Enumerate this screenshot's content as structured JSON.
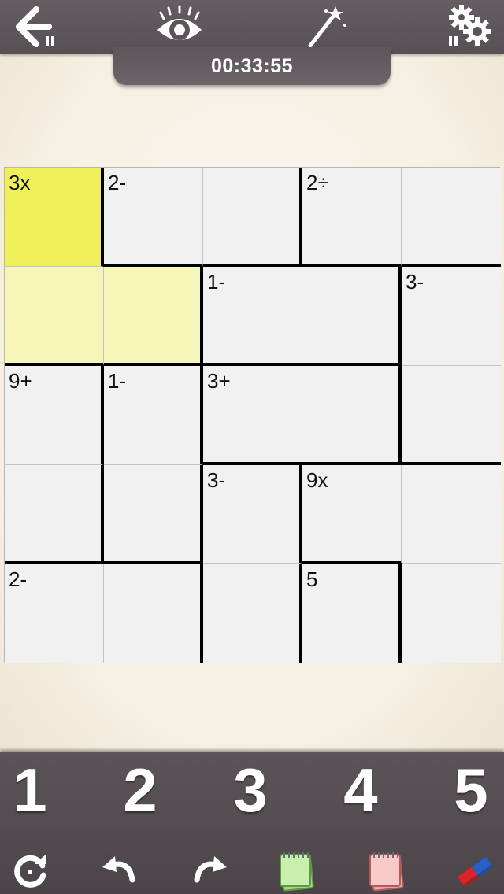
{
  "header": {
    "timer": "00:33:55",
    "icons": [
      "back-icon",
      "eye-icon",
      "magic-wand-icon",
      "settings-icon"
    ]
  },
  "puzzle": {
    "size": 5,
    "cells": [
      {
        "clue": "3x",
        "state": "selected"
      },
      {
        "clue": "2-",
        "state": "normal"
      },
      {
        "clue": "",
        "state": "normal"
      },
      {
        "clue": "2÷",
        "state": "normal"
      },
      {
        "clue": "",
        "state": "normal"
      },
      {
        "clue": "",
        "state": "cage-highlight"
      },
      {
        "clue": "",
        "state": "cage-highlight"
      },
      {
        "clue": "1-",
        "state": "normal"
      },
      {
        "clue": "",
        "state": "normal"
      },
      {
        "clue": "3-",
        "state": "normal"
      },
      {
        "clue": "9+",
        "state": "normal"
      },
      {
        "clue": "1-",
        "state": "normal"
      },
      {
        "clue": "3+",
        "state": "normal"
      },
      {
        "clue": "",
        "state": "normal"
      },
      {
        "clue": "",
        "state": "normal"
      },
      {
        "clue": "",
        "state": "normal"
      },
      {
        "clue": "",
        "state": "normal"
      },
      {
        "clue": "3-",
        "state": "normal"
      },
      {
        "clue": "9x",
        "state": "normal"
      },
      {
        "clue": "",
        "state": "normal"
      },
      {
        "clue": "2-",
        "state": "normal"
      },
      {
        "clue": "",
        "state": "normal"
      },
      {
        "clue": "",
        "state": "normal"
      },
      {
        "clue": "5",
        "state": "normal"
      },
      {
        "clue": ""
      }
    ]
  },
  "keypad": {
    "numbers": [
      "1",
      "2",
      "3",
      "4",
      "5"
    ]
  },
  "toolbar": {
    "icons": [
      "restart-icon",
      "undo-icon",
      "redo-icon",
      "notes-green-icon",
      "notes-red-icon",
      "eraser-icon"
    ]
  },
  "colors": {
    "selected": "#eff05a",
    "cage_highlight": "#f5f6b8",
    "cell": "#f1f1f1",
    "bar": "#5a5257"
  }
}
